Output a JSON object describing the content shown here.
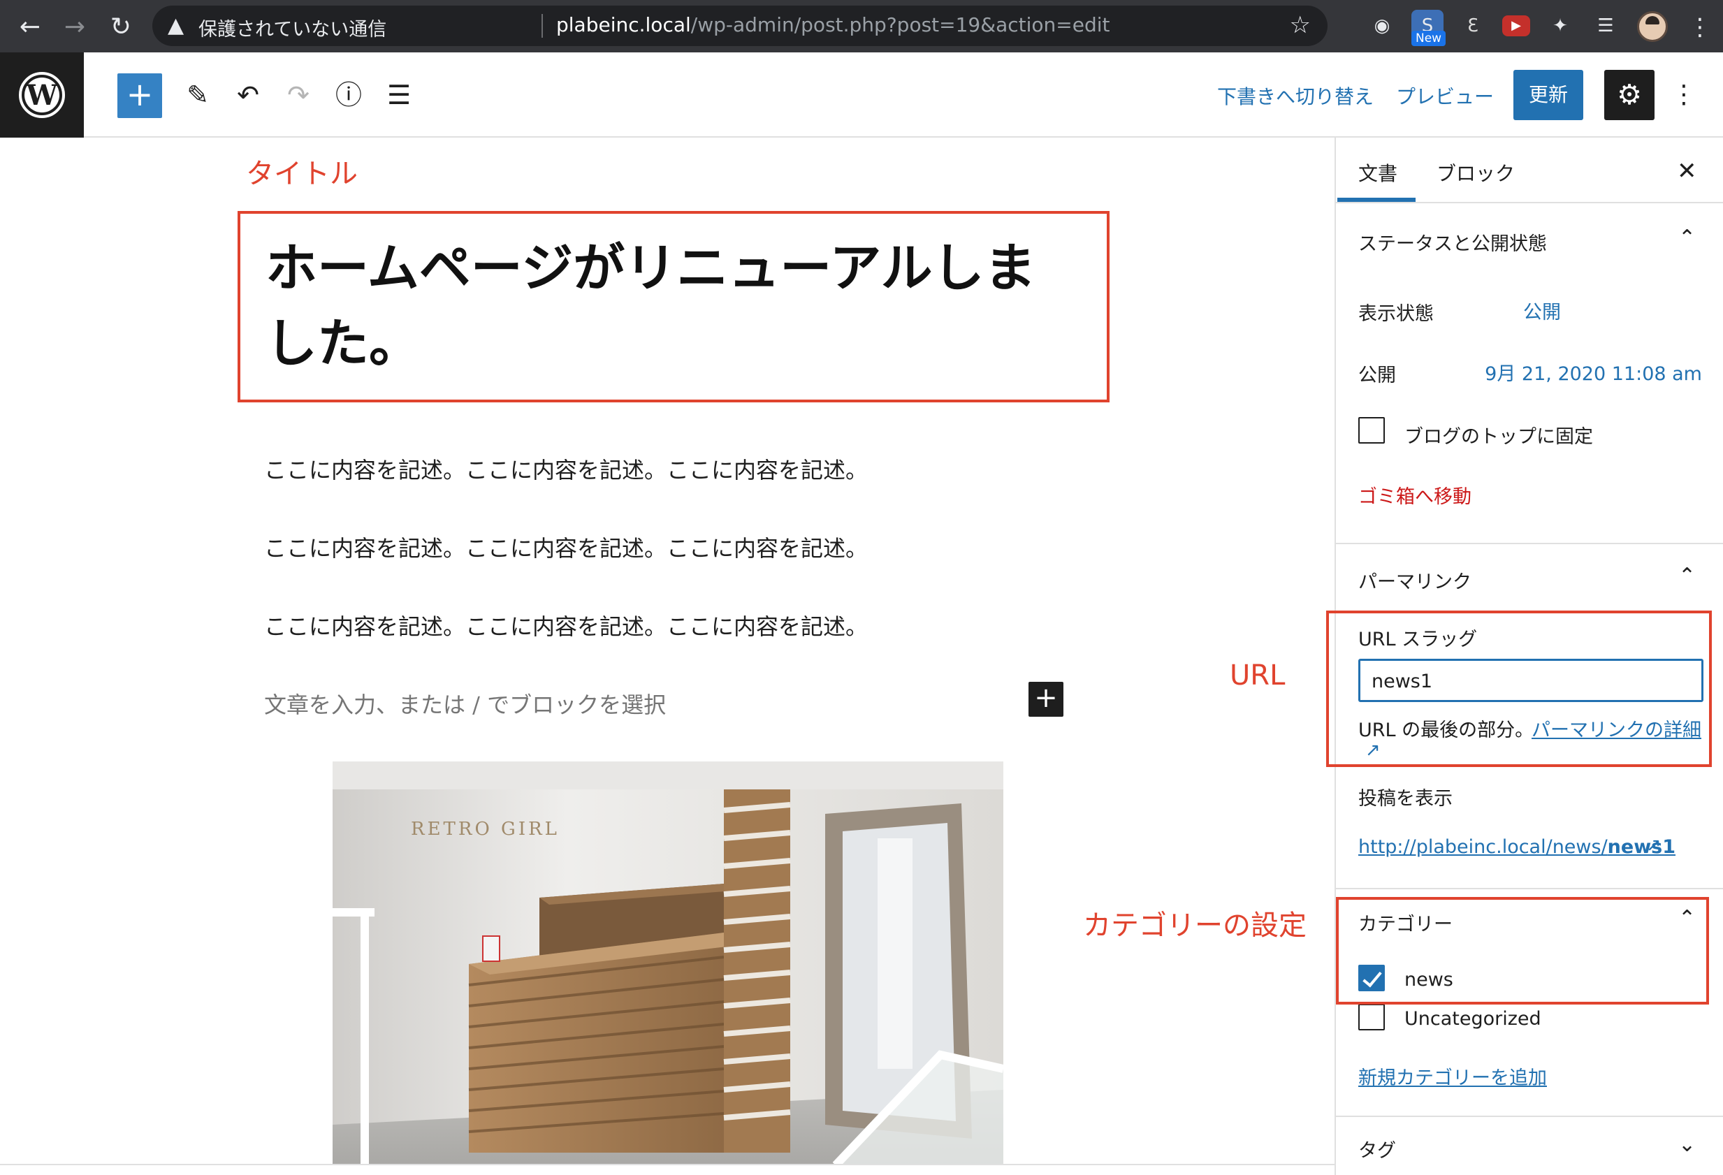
{
  "browser": {
    "security_label": "保護されていない通信",
    "url_host": "plabeinc.local",
    "url_path": "/wp-admin/post.php?post=19&action=edit",
    "extension_badge": "New"
  },
  "header": {
    "switch_to_draft": "下書きへ切り替え",
    "preview": "プレビュー",
    "update": "更新"
  },
  "annotations": {
    "title": "タイトル",
    "url": "URL",
    "category": "カテゴリーの設定"
  },
  "editor": {
    "title": "ホームページがリニューアルしました。",
    "paragraphs": [
      "ここに内容を記述。ここに内容を記述。ここに内容を記述。",
      "ここに内容を記述。ここに内容を記述。ここに内容を記述。",
      "ここに内容を記述。ここに内容を記述。ここに内容を記述。"
    ],
    "placeholder": "文章を入力、または / でブロックを選択",
    "image_sign_text": "RETRO GIRL"
  },
  "sidebar": {
    "tabs": [
      "文書",
      "ブロック"
    ],
    "status_panel": {
      "title": "ステータスと公開状態",
      "visibility_label": "表示状態",
      "visibility_value": "公開",
      "publish_label": "公開",
      "publish_value": "9月 21, 2020 11:08 am",
      "sticky_label": "ブログのトップに固定",
      "sticky_checked": false,
      "trash": "ゴミ箱へ移動"
    },
    "permalink_panel": {
      "title": "パーマリンク",
      "slug_label": "URL スラッグ",
      "slug_value": "news1",
      "help_text": "URL の最後の部分。",
      "help_link": "パーマリンクの詳細",
      "view_post_label": "投稿を表示",
      "post_url_prefix": "http://plabeinc.local/news/",
      "post_url_slug": "news1"
    },
    "category_panel": {
      "title": "カテゴリー",
      "items": [
        {
          "label": "news",
          "checked": true
        },
        {
          "label": "Uncategorized",
          "checked": false
        }
      ],
      "add_new": "新規カテゴリーを追加"
    },
    "tag_panel": {
      "title": "タグ"
    }
  },
  "colors": {
    "accent": "#2271b1",
    "annotation": "#e0432e",
    "danger": "#cc1818"
  }
}
